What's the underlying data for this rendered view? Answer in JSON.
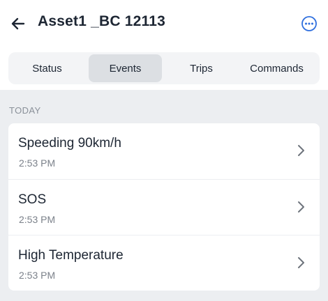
{
  "header": {
    "title": "Asset1 _BC 12113",
    "back_icon": "arrow-left-icon",
    "more_icon": "more-horizontal-circle-icon"
  },
  "tabs": [
    {
      "label": "Status",
      "active": false
    },
    {
      "label": "Events",
      "active": true
    },
    {
      "label": "Trips",
      "active": false
    },
    {
      "label": "Commands",
      "active": false
    }
  ],
  "section": {
    "label": "TODAY"
  },
  "events": [
    {
      "title": "Speeding 90km/h",
      "time": "2:53 PM"
    },
    {
      "title": "SOS",
      "time": "2:53 PM"
    },
    {
      "title": "High Temperature",
      "time": "2:53 PM"
    }
  ],
  "colors": {
    "accent": "#2f6fde",
    "text": "#1d2633",
    "muted": "#7b818a",
    "background": "#eceef1",
    "tab_active": "#dcdfe3"
  }
}
